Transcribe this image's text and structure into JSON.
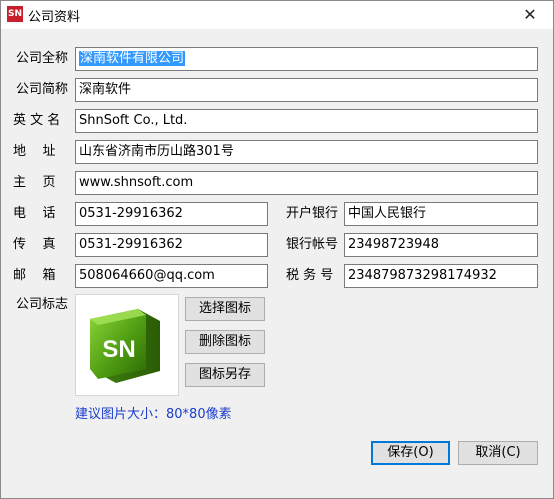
{
  "window": {
    "icon_text": "SN",
    "title": "公司资料",
    "close_symbol": "✕"
  },
  "form": {
    "full_name": {
      "label": "公司全称",
      "value": "深南软件有限公司"
    },
    "short_name": {
      "label": "公司简称",
      "value": "深南软件"
    },
    "english_name": {
      "label": "英 文 名",
      "value": "ShnSoft Co., Ltd."
    },
    "address": {
      "label": "地    址",
      "value": "山东省济南市历山路301号"
    },
    "homepage": {
      "label": "主    页",
      "value": "www.shnsoft.com"
    },
    "phone": {
      "label": "电    话",
      "value": "0531-29916362"
    },
    "fax": {
      "label": "传    真",
      "value": "0531-29916362"
    },
    "email": {
      "label": "邮    箱",
      "value": "508064660@qq.com"
    },
    "bank": {
      "label": "开户银行",
      "value": "中国人民银行"
    },
    "bank_account": {
      "label": "银行帐号",
      "value": "23498723948"
    },
    "tax_id": {
      "label": "税 务 号",
      "value": "234879873298174932"
    },
    "logo": {
      "label": "公司标志",
      "logo_text": "SN"
    }
  },
  "logo_buttons": {
    "select": "选择图标",
    "delete": "删除图标",
    "save_as": "图标另存"
  },
  "hint": "建议图片大小：80*80像素",
  "footer": {
    "save": "保存(O)",
    "cancel": "取消(C)"
  },
  "colors": {
    "selection": "#3399ff",
    "hint_text": "#1a3dcc",
    "logo_green": "#5ea818",
    "app_icon": "#c8202a"
  }
}
